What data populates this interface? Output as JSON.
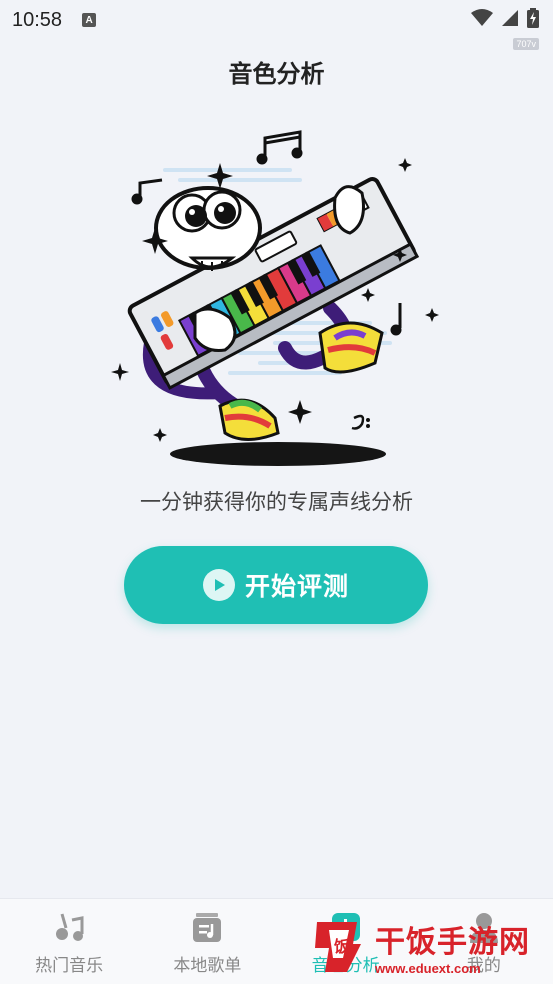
{
  "status_bar": {
    "time": "10:58",
    "notification_badge": "A",
    "speed_badge": "707v",
    "wifi_icon": "wifi-icon",
    "signal_icon": "signal-icon",
    "battery_icon": "battery-charging-icon"
  },
  "header": {
    "title": "音色分析"
  },
  "main": {
    "subtitle": "一分钟获得你的专属声线分析",
    "start_button_label": "开始评测",
    "start_button_icon": "play-icon",
    "illustration": "keyboard-character-illustration"
  },
  "tabs": [
    {
      "label": "热门音乐",
      "icon": "music-note-icon",
      "active": false
    },
    {
      "label": "本地歌单",
      "icon": "playlist-icon",
      "active": false
    },
    {
      "label": "音色分析",
      "icon": "analysis-icon",
      "active": true
    },
    {
      "label": "我的",
      "icon": "user-icon",
      "active": false
    }
  ],
  "watermark": {
    "name": "干饭手游网",
    "url": "www.eduext.com"
  },
  "colors": {
    "accent": "#1fbfb4",
    "background": "#f1f3f8",
    "watermark_red": "#d8232a"
  }
}
